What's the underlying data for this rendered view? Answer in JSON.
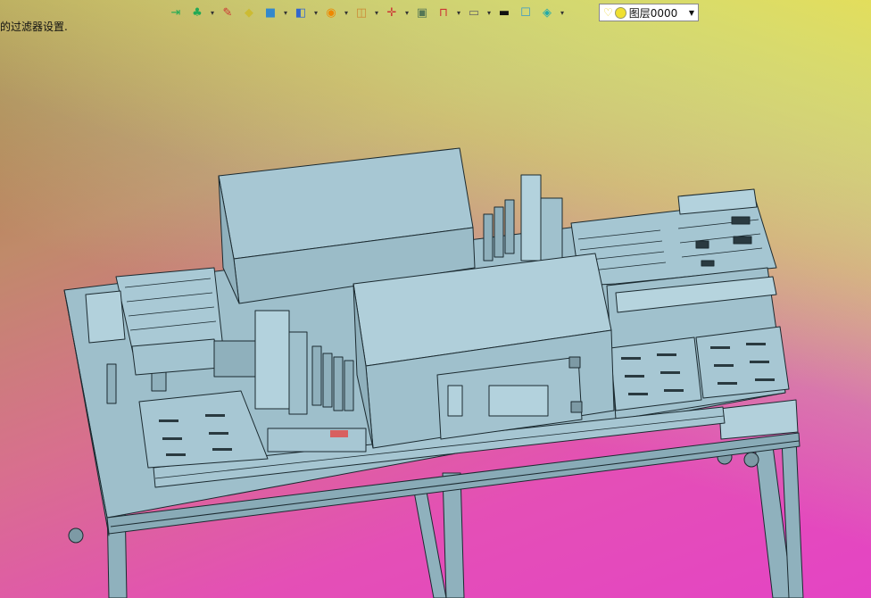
{
  "status": {
    "message": "的过滤器设置."
  },
  "toolbar": {
    "icons": [
      "insert-icon",
      "paint-icon",
      "pencil-icon",
      "box-icon",
      "solid-icon",
      "view-icon",
      "orbit-icon",
      "zoom-icon",
      "origin-icon",
      "frame-icon",
      "section-icon",
      "display-icon",
      "line-icon",
      "color-icon",
      "layer-stack-icon"
    ]
  },
  "layer": {
    "label": "图层0000"
  },
  "colors": {
    "model": "#a2c3cf",
    "edge": "#1b2a30"
  }
}
